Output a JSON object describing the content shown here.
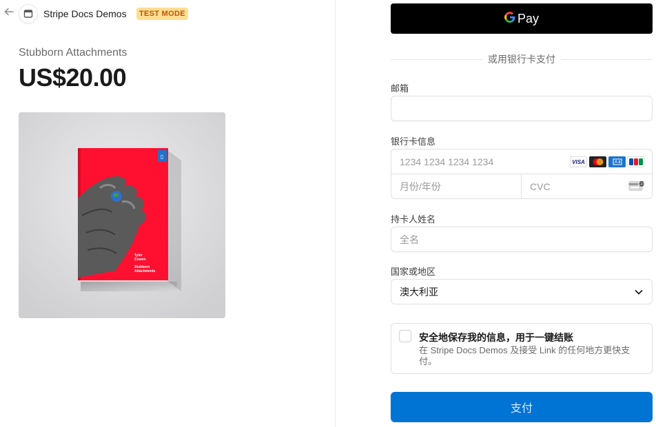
{
  "header": {
    "back_icon": "arrow-left-icon",
    "merchant_name": "Stripe Docs Demos",
    "test_badge": "TEST MODE"
  },
  "product": {
    "name": "Stubborn Attachments",
    "price": "US$20.00",
    "book_author": "Tyler\nCowen",
    "book_title": "Stubborn\nAttachments"
  },
  "payment": {
    "gpay_g": "G",
    "gpay_label": "Pay",
    "or_text": "或用银行卡支付",
    "email_label": "邮箱",
    "email_value": "",
    "card_label": "银行卡信息",
    "card_number_placeholder": "1234 1234 1234 1234",
    "card_brands": [
      "VISA",
      "mastercard",
      "AMEX",
      "JCB"
    ],
    "expiry_placeholder": "月份/年份",
    "cvc_placeholder": "CVC",
    "cvc_icon": "card-back-icon",
    "name_label": "持卡人姓名",
    "name_placeholder": "全名",
    "country_label": "国家或地区",
    "country_value": "澳大利亚",
    "save_title": "安全地保存我的信息，用于一键结账",
    "save_desc": "在 Stripe Docs Demos 及接受 Link 的任何地方更快支付。",
    "pay_button": "支付"
  },
  "colors": {
    "pay_button": "#0074d4",
    "test_badge_bg": "#ffde92",
    "test_badge_text": "#bb5504",
    "book_red": "#ff1030"
  }
}
